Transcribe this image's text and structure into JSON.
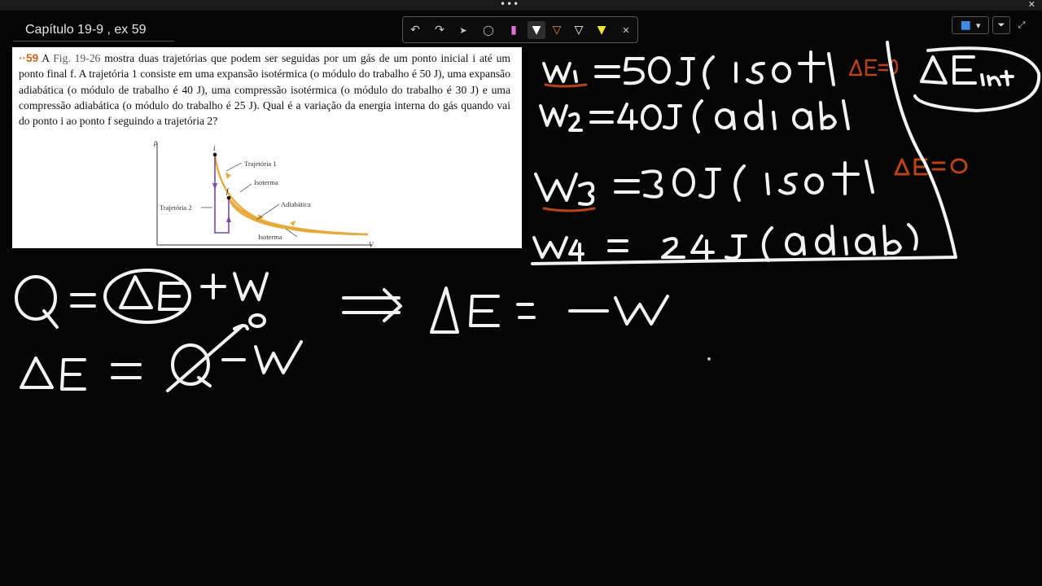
{
  "window": {
    "menu_dots": "•••",
    "close": "✕"
  },
  "page_title": "Capítulo 19-9 , ex 59",
  "toolbar": {
    "tools": [
      {
        "name": "undo-icon",
        "glyph": "↶"
      },
      {
        "name": "redo-icon",
        "glyph": "↷"
      },
      {
        "name": "select-icon",
        "glyph": "➤"
      },
      {
        "name": "lasso-icon",
        "glyph": "◯"
      },
      {
        "name": "pen-icon",
        "glyph": "▮"
      },
      {
        "name": "pen-selected-icon",
        "glyph": "▼"
      },
      {
        "name": "pen-orange-icon",
        "glyph": "▽"
      },
      {
        "name": "pen-white-icon",
        "glyph": "▽"
      },
      {
        "name": "highlighter-icon",
        "glyph": "▼"
      },
      {
        "name": "close-icon",
        "glyph": "✕"
      }
    ]
  },
  "right_tools": {
    "notebook_icon": "■",
    "chevron": "▾",
    "filter_icon": "⏷",
    "expand_icon": "⤢"
  },
  "problem": {
    "number": "··59",
    "fig_ref": "Fig. 19-26",
    "text": "mostra duas trajetórias que podem ser seguidas por um gás de um ponto inicial i até um ponto final f. A trajetória 1 consiste em uma expansão isotérmica (o módulo do trabalho é 50 J), uma expansão adiabática (o módulo de trabalho é 40 J), uma compressão isotérmica (o módulo do trabalho é 30 J) e uma compressão adiabática (o módulo do trabalho é 25 J). Qual é a variação da energia interna do gás quando vai do ponto i ao ponto f seguindo a trajetória 2?",
    "lead": "A"
  },
  "figure": {
    "axis_p": "p",
    "axis_v": "V",
    "point_i": "i",
    "point_f": "f",
    "label_traj1": "Trajetória 1",
    "label_isoterma_top": "Isoterma",
    "label_adiabatica": "Adiabática",
    "label_traj2": "Trajetória 2",
    "label_isoterma_bottom": "Isoterma"
  },
  "colors": {
    "ink_white": "#f2f2f2",
    "ink_orange": "#b8431b",
    "curve": "#e9a93a",
    "path2": "#7b4aa3"
  }
}
